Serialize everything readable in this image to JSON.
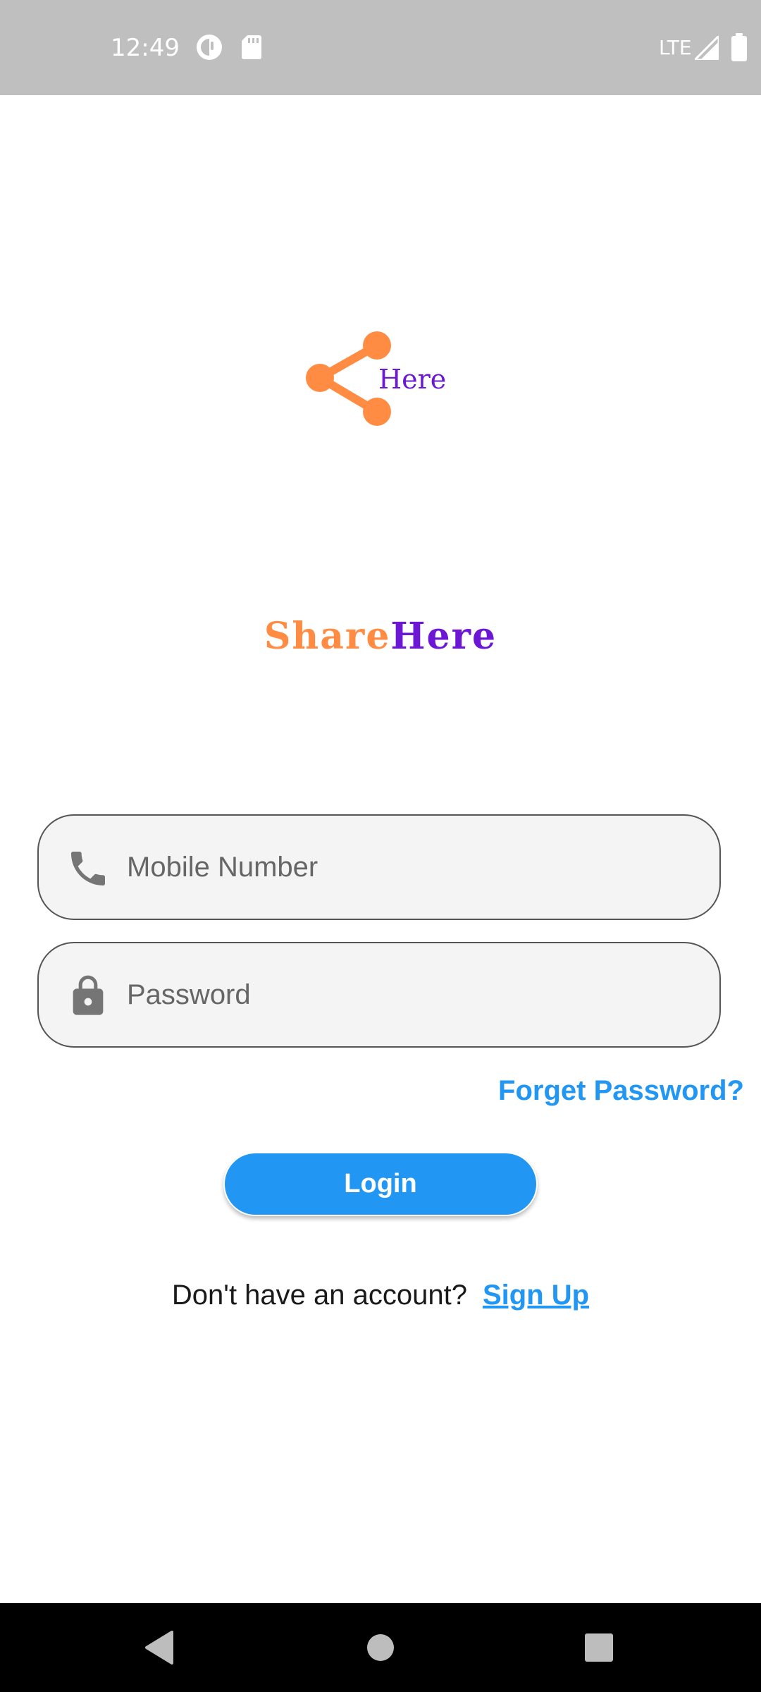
{
  "status_bar": {
    "time": "12:49",
    "network": "LTE"
  },
  "logo": {
    "text": "Here",
    "icon": "share-icon",
    "icon_color": "#ff8c42",
    "text_color": "#6b17d4"
  },
  "app_name": {
    "part1": "Share",
    "part2": "Here"
  },
  "form": {
    "mobile_placeholder": "Mobile Number",
    "mobile_icon": "phone-icon",
    "password_placeholder": "Password",
    "password_icon": "lock-icon",
    "forget_password": "Forget Password?",
    "login_label": "Login"
  },
  "signup": {
    "prompt": "Don't have an account?",
    "link": "Sign Up"
  },
  "colors": {
    "accent": "#2196f3",
    "brand_orange": "#ff8c42",
    "brand_purple": "#6b17d4"
  },
  "nav_bar": {
    "icons": [
      "back-icon",
      "home-icon",
      "recents-icon"
    ]
  }
}
